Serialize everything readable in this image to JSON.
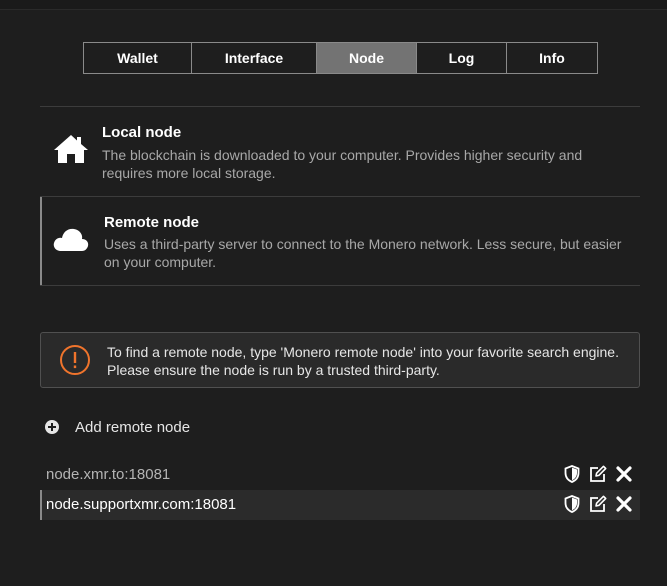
{
  "tabs": [
    {
      "label": "Wallet"
    },
    {
      "label": "Interface"
    },
    {
      "label": "Node"
    },
    {
      "label": "Log"
    },
    {
      "label": "Info"
    }
  ],
  "active_tab": "Node",
  "options": {
    "local": {
      "title": "Local node",
      "description": "The blockchain is downloaded to your computer. Provides higher security and requires more local storage.",
      "icon": "home-icon"
    },
    "remote": {
      "title": "Remote node",
      "description": "Uses a third-party server to connect to the Monero network. Less secure, but easier on your computer.",
      "icon": "cloud-icon"
    }
  },
  "warning": {
    "icon": "exclamation-circle-icon",
    "text": "To find a remote node, type 'Monero remote node' into your favorite search engine. Please ensure the node is run by a trusted third-party."
  },
  "add_node": {
    "label": "Add remote node",
    "icon": "plus-circle-icon"
  },
  "nodes": [
    {
      "address": "node.xmr.to:18081"
    },
    {
      "address": "node.supportxmr.com:18081"
    }
  ],
  "colors": {
    "accent_warning": "#f0742c",
    "active_tab": "#737373",
    "background": "#1e1e1e"
  }
}
